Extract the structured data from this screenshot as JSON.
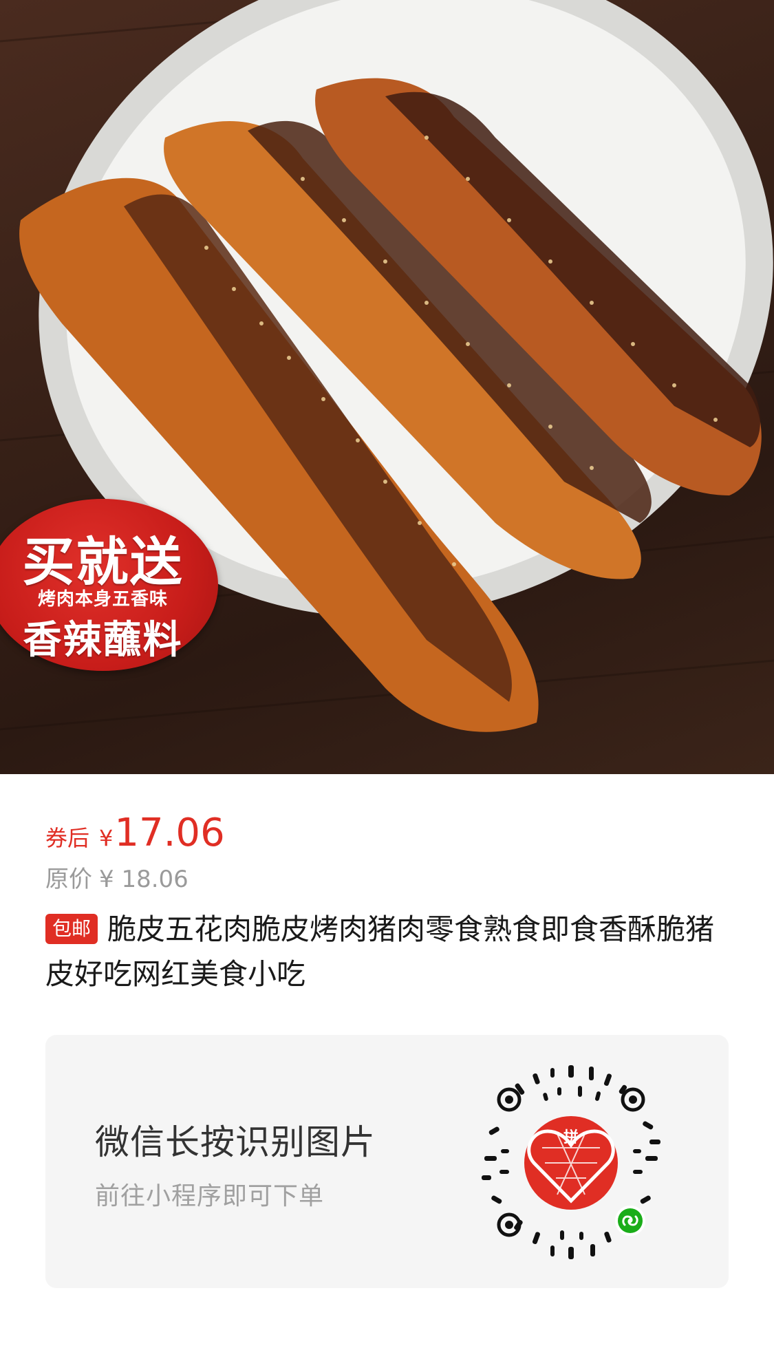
{
  "product": {
    "image_alt": "crispy pork belly on white plate",
    "promo_badge": {
      "line1": "买就送",
      "line2": "烤肉本身五香味",
      "line3": "香辣蘸料"
    },
    "price_label": "券后",
    "currency": "¥",
    "price": "17.06",
    "original_price_label": "原价",
    "original_price": "¥ 18.06",
    "shipping_tag": "包邮",
    "title": "脆皮五花肉脆皮烤肉猪肉零食熟食即食香酥脆猪皮好吃网红美食小吃"
  },
  "qr_card": {
    "heading": "微信长按识别图片",
    "subheading": "前往小程序即可下单",
    "qr_icon": "pinduoduo-miniprogram-qr-icon",
    "center_logo_text": "拼"
  },
  "colors": {
    "accent_red": "#e02e24",
    "muted_gray": "#9a9a9a",
    "card_bg": "#f5f5f5",
    "wechat_green": "#1aad19"
  }
}
